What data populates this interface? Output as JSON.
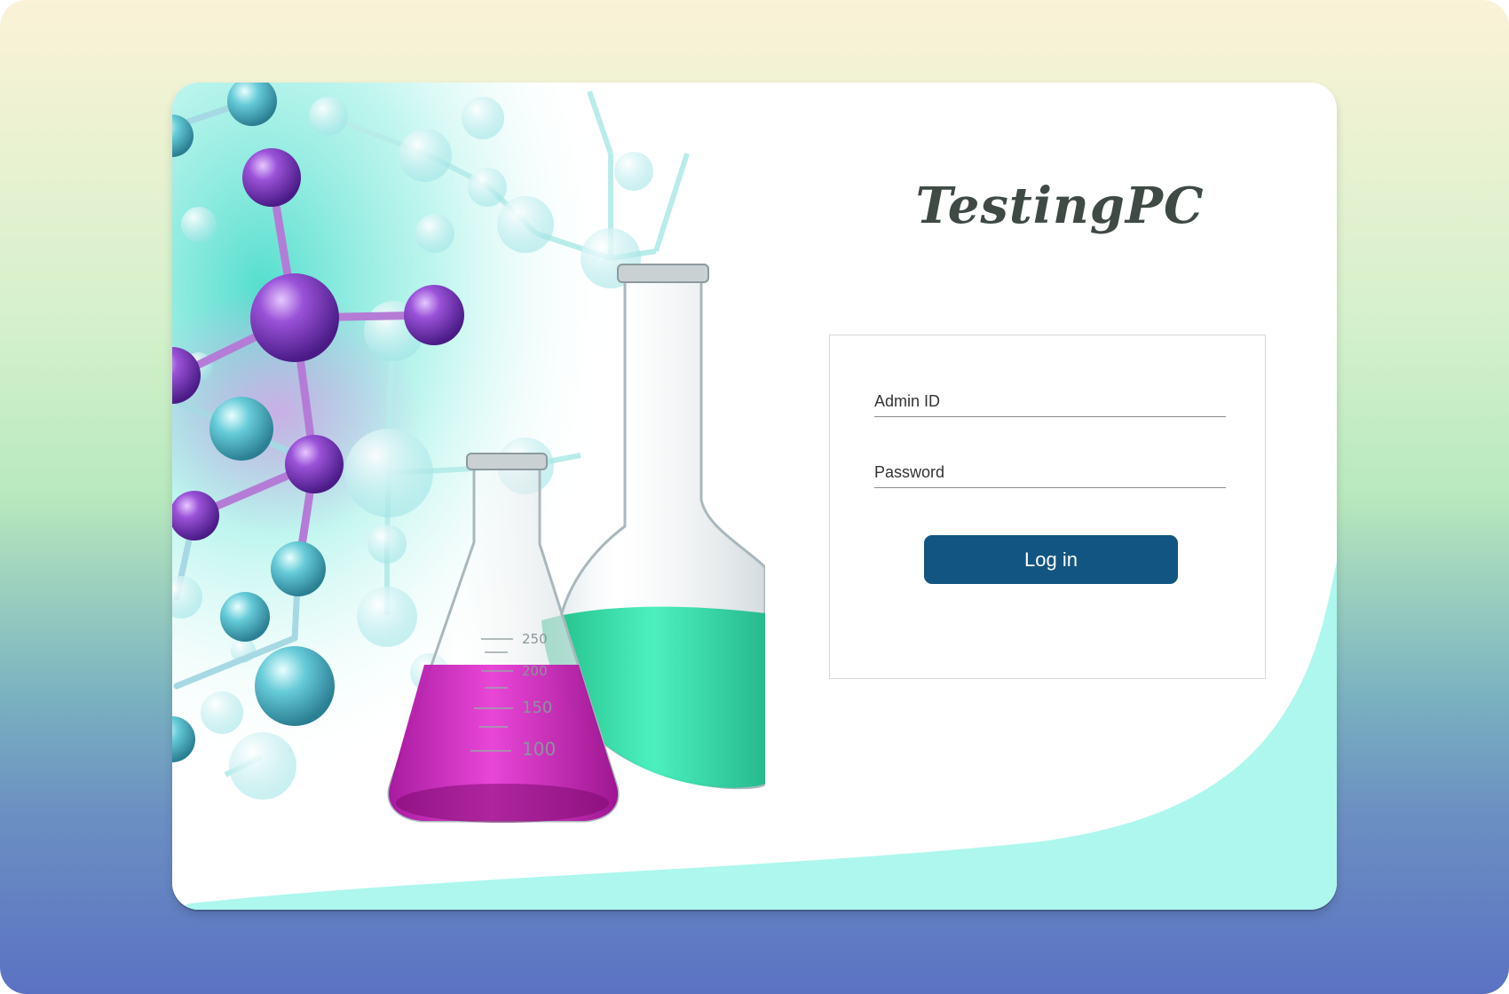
{
  "app": {
    "title": "TestingPC"
  },
  "login_form": {
    "admin_id_label": "Admin ID",
    "password_label": "Password",
    "submit_label": "Log in"
  },
  "hero_illustration": {
    "flask_markings": [
      "250",
      "200",
      "150",
      "100"
    ],
    "liquid_colors": {
      "erlenmeyer": "#d41fc2",
      "round_flask": "#2fe0a8"
    },
    "molecule_colors": {
      "purple": "#8b3fc4",
      "teal": "#5cc6d3"
    }
  },
  "colors": {
    "accent": "#125582",
    "title_text": "#3f4a44",
    "wave": "#adf7ee"
  }
}
